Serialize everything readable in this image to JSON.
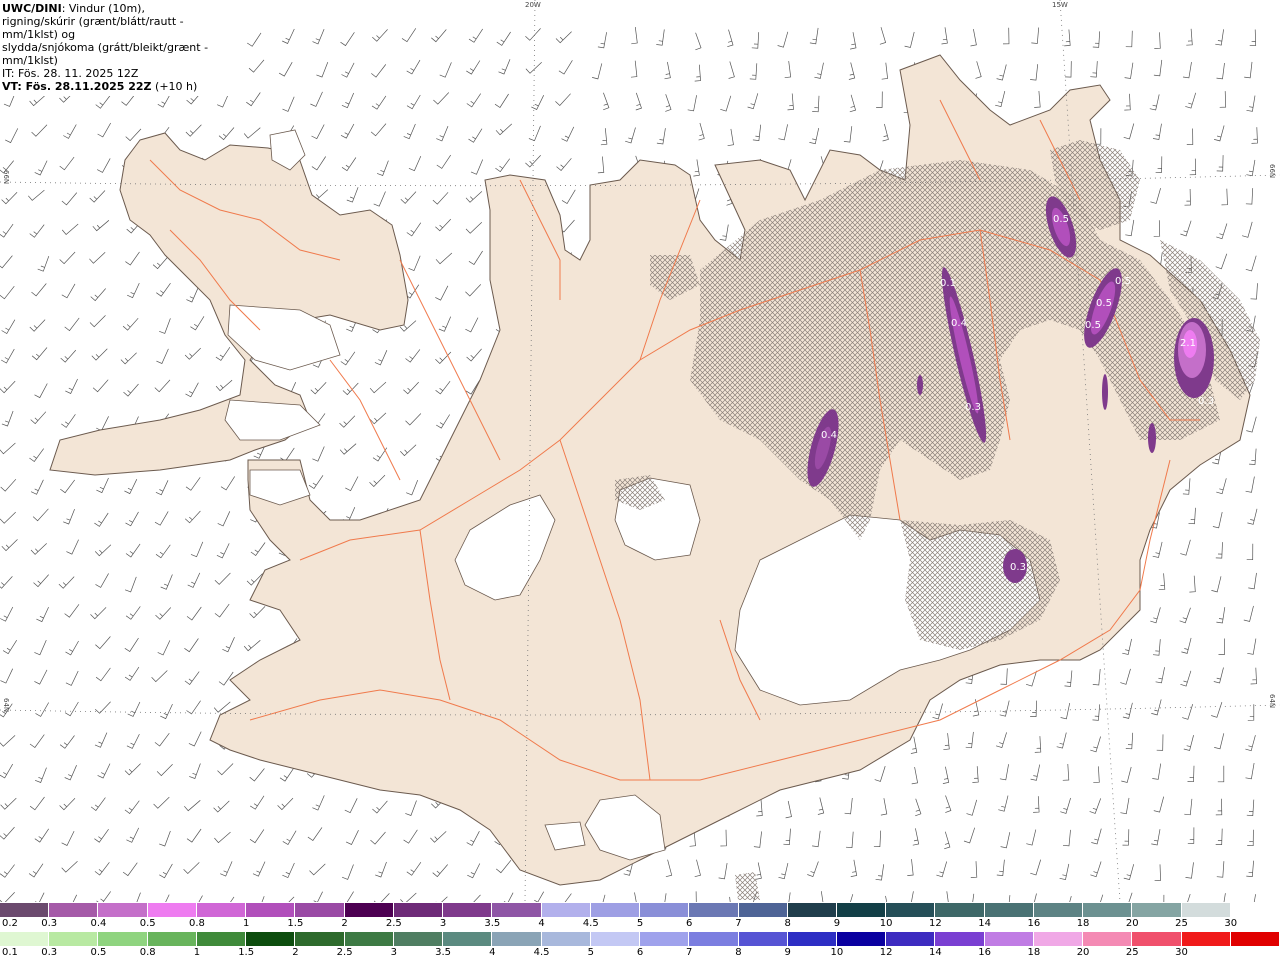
{
  "header": {
    "source": "UWC/DINI",
    "line1_rest": ": Vindur (10m),",
    "line2": "rigning/skúrir (grænt/blátt/rautt - mm/1klst) og",
    "line3": "slydda/snjókoma (grátt/bleikt/grænt - mm/1klst)",
    "init_time": "IT: Fös. 28. 11. 2025 12Z",
    "valid_label": "VT: Fös. 28.11.2025 22Z",
    "valid_offset": " (+10 h)"
  },
  "grid_labels": {
    "lon_20w": "20W",
    "lon_15w": "15W",
    "lat_66n_left": "66N",
    "lat_66n_right": "66N",
    "lat_64n_left": "64N",
    "lat_64n_right": "64N"
  },
  "precip_labels": [
    "0.5",
    "0.5",
    "0.5",
    "0.5",
    "0.1",
    "0.4",
    "0.3",
    "0.4",
    "2.1",
    "0.3",
    "0.3"
  ],
  "legend_snow": {
    "values": [
      "0.2",
      "0.3",
      "0.4",
      "0.5",
      "0.8",
      "1",
      "1.5",
      "2",
      "2.5",
      "3",
      "3.5",
      "4",
      "4.5",
      "5",
      "6",
      "7",
      "8",
      "9",
      "10",
      "12",
      "14",
      "16",
      "18",
      "20",
      "25",
      "30"
    ],
    "colors": [
      "#6b4a6e",
      "#a55aa8",
      "#c46fc9",
      "#ee7cf0",
      "#d066d6",
      "#b14fbb",
      "#9a4aa5",
      "#4d0052",
      "#6e2a78",
      "#7f3a8c",
      "#8f56a6",
      "#b2b0ec",
      "#9e9fe4",
      "#8a8fd8",
      "#6b78b4",
      "#4e6496",
      "#203e4c",
      "#133f47",
      "#254f58",
      "#3e6868",
      "#4a7274",
      "#5d8384",
      "#6c9191",
      "#85a5a3",
      "#d3dcdc",
      "#ffffff"
    ]
  },
  "legend_rain": {
    "values": [
      "0.1",
      "0.3",
      "0.5",
      "0.8",
      "1",
      "1.5",
      "2",
      "2.5",
      "3",
      "3.5",
      "4",
      "4.5",
      "5",
      "6",
      "7",
      "8",
      "9",
      "10",
      "12",
      "14",
      "16",
      "18",
      "20",
      "25",
      "30"
    ],
    "colors": [
      "#dff7d2",
      "#b8e9a2",
      "#8fd47f",
      "#68b45c",
      "#3f8a3a",
      "#0d4d0e",
      "#2d6a2c",
      "#3d7a44",
      "#4f7e62",
      "#5b8a80",
      "#8aa4b6",
      "#a8b8dc",
      "#c3c8f4",
      "#9fa2ec",
      "#7b7ee0",
      "#5654d4",
      "#2d2ec4",
      "#0a00a0",
      "#3d2bc0",
      "#7a3fd2",
      "#c07ce4",
      "#f0a8e6",
      "#f48ab4",
      "#f0506c",
      "#f01a1a",
      "#e00000"
    ]
  },
  "colors": {
    "land": "#f3e5d6",
    "coast": "#6b5a4e",
    "roads": "#f07a4c",
    "ice": "#ffffff",
    "snow_hatch": "#8a7f78",
    "snow_precip": "#8e4aa8"
  }
}
